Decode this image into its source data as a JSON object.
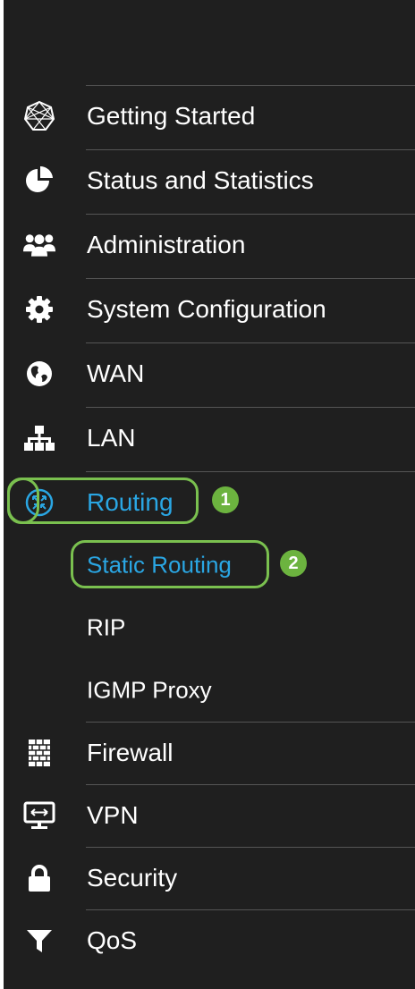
{
  "menu": {
    "items": [
      {
        "label": "Getting Started",
        "icon": "getting-started-icon"
      },
      {
        "label": "Status and Statistics",
        "icon": "pie-chart-icon"
      },
      {
        "label": "Administration",
        "icon": "users-icon"
      },
      {
        "label": "System Configuration",
        "icon": "gear-icon"
      },
      {
        "label": "WAN",
        "icon": "globe-icon"
      },
      {
        "label": "LAN",
        "icon": "network-icon"
      },
      {
        "label": "Routing",
        "icon": "routing-icon",
        "state": "expanded"
      },
      {
        "label": "Static Routing",
        "state": "selected"
      },
      {
        "label": "RIP"
      },
      {
        "label": "IGMP Proxy"
      },
      {
        "label": "Firewall",
        "icon": "firewall-icon"
      },
      {
        "label": "VPN",
        "icon": "vpn-icon"
      },
      {
        "label": "Security",
        "icon": "lock-icon"
      },
      {
        "label": "QoS",
        "icon": "filter-icon"
      }
    ]
  },
  "callouts": {
    "step1": "1",
    "step2": "2"
  },
  "colors": {
    "background": "#1f1f1f",
    "text": "#ffffff",
    "active_text": "#2aa6e3",
    "highlight": "#7ac04f",
    "separator": "#555555"
  }
}
